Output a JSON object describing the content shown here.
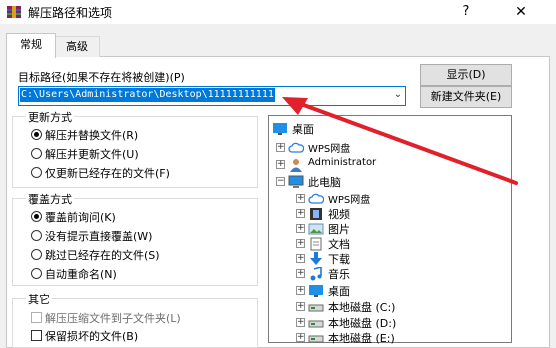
{
  "window": {
    "title": "解压路径和选项",
    "help_glyph": "?",
    "close_glyph": "✕"
  },
  "tabs": [
    {
      "label": "常规",
      "active": true
    },
    {
      "label": "高级",
      "active": false
    }
  ],
  "destination": {
    "label": "目标路径(如果不存在将被创建)(P)",
    "value": "C:\\Users\\Administrator\\Desktop\\11111111111"
  },
  "buttons": {
    "show": "显示(D)",
    "new_folder": "新建文件夹(E)"
  },
  "update_mode": {
    "title": "更新方式",
    "options": [
      {
        "label": "解压并替换文件(R)",
        "selected": true
      },
      {
        "label": "解压并更新文件(U)",
        "selected": false
      },
      {
        "label": "仅更新已经存在的文件(F)",
        "selected": false
      }
    ]
  },
  "overwrite_mode": {
    "title": "覆盖方式",
    "options": [
      {
        "label": "覆盖前询问(K)",
        "selected": true
      },
      {
        "label": "没有提示直接覆盖(W)",
        "selected": false
      },
      {
        "label": "跳过已经存在的文件(S)",
        "selected": false
      },
      {
        "label": "自动重命名(N)",
        "selected": false
      }
    ]
  },
  "misc": {
    "title": "其它",
    "options": [
      {
        "label": "解压压缩文件到子文件夹(L)",
        "checked": false,
        "disabled": true
      },
      {
        "label": "保留损坏的文件(B)",
        "checked": false,
        "disabled": false
      }
    ]
  },
  "tree": {
    "items": [
      {
        "label": "桌面",
        "icon": "desktop-icon",
        "expander": ""
      },
      {
        "label": "WPS网盘",
        "icon": "cloud-icon",
        "expander": "+"
      },
      {
        "label": "Administrator",
        "icon": "user-icon",
        "expander": "+"
      },
      {
        "label": "此电脑",
        "icon": "computer-icon",
        "expander": "−"
      },
      {
        "label": "WPS网盘",
        "icon": "cloud-icon",
        "expander": "+"
      },
      {
        "label": "视频",
        "icon": "video-icon",
        "expander": "+"
      },
      {
        "label": "图片",
        "icon": "pictures-icon",
        "expander": "+"
      },
      {
        "label": "文档",
        "icon": "documents-icon",
        "expander": "+"
      },
      {
        "label": "下载",
        "icon": "download-icon",
        "expander": "+"
      },
      {
        "label": "音乐",
        "icon": "music-icon",
        "expander": "+"
      },
      {
        "label": "桌面",
        "icon": "desktop-icon",
        "expander": "+"
      },
      {
        "label": "本地磁盘 (C:)",
        "icon": "drive-icon",
        "expander": "+"
      },
      {
        "label": "本地磁盘 (D:)",
        "icon": "drive-icon",
        "expander": "+"
      },
      {
        "label": "本地磁盘 (E:)",
        "icon": "drive-icon",
        "expander": "+"
      }
    ]
  },
  "colors": {
    "selection": "#0078d7",
    "annotation_arrow": "#e0202a"
  }
}
